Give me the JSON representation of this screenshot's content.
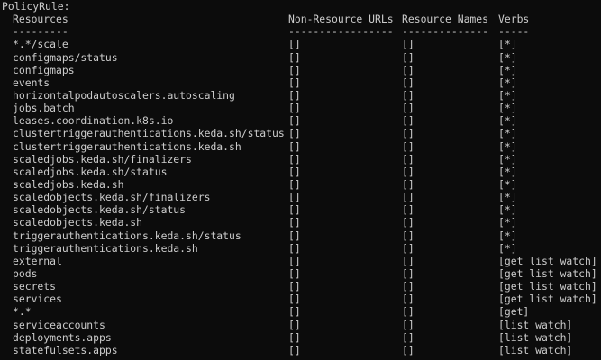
{
  "terminal": {
    "heading": "PolicyRule:",
    "columns": {
      "resources": "Resources",
      "non_resource_urls": "Non-Resource URLs",
      "resource_names": "Resource Names",
      "verbs": "Verbs"
    },
    "separators": {
      "resources": "---------",
      "non_resource_urls": "-----------------",
      "resource_names": "--------------",
      "verbs": "-----"
    },
    "rows": [
      {
        "resource": "*.*/scale",
        "non_resource_urls": "[]",
        "resource_names": "[]",
        "verbs": "[*]"
      },
      {
        "resource": "configmaps/status",
        "non_resource_urls": "[]",
        "resource_names": "[]",
        "verbs": "[*]"
      },
      {
        "resource": "configmaps",
        "non_resource_urls": "[]",
        "resource_names": "[]",
        "verbs": "[*]"
      },
      {
        "resource": "events",
        "non_resource_urls": "[]",
        "resource_names": "[]",
        "verbs": "[*]"
      },
      {
        "resource": "horizontalpodautoscalers.autoscaling",
        "non_resource_urls": "[]",
        "resource_names": "[]",
        "verbs": "[*]"
      },
      {
        "resource": "jobs.batch",
        "non_resource_urls": "[]",
        "resource_names": "[]",
        "verbs": "[*]"
      },
      {
        "resource": "leases.coordination.k8s.io",
        "non_resource_urls": "[]",
        "resource_names": "[]",
        "verbs": "[*]"
      },
      {
        "resource": "clustertriggerauthentications.keda.sh/status",
        "non_resource_urls": "[]",
        "resource_names": "[]",
        "verbs": "[*]"
      },
      {
        "resource": "clustertriggerauthentications.keda.sh",
        "non_resource_urls": "[]",
        "resource_names": "[]",
        "verbs": "[*]"
      },
      {
        "resource": "scaledjobs.keda.sh/finalizers",
        "non_resource_urls": "[]",
        "resource_names": "[]",
        "verbs": "[*]"
      },
      {
        "resource": "scaledjobs.keda.sh/status",
        "non_resource_urls": "[]",
        "resource_names": "[]",
        "verbs": "[*]"
      },
      {
        "resource": "scaledjobs.keda.sh",
        "non_resource_urls": "[]",
        "resource_names": "[]",
        "verbs": "[*]"
      },
      {
        "resource": "scaledobjects.keda.sh/finalizers",
        "non_resource_urls": "[]",
        "resource_names": "[]",
        "verbs": "[*]"
      },
      {
        "resource": "scaledobjects.keda.sh/status",
        "non_resource_urls": "[]",
        "resource_names": "[]",
        "verbs": "[*]"
      },
      {
        "resource": "scaledobjects.keda.sh",
        "non_resource_urls": "[]",
        "resource_names": "[]",
        "verbs": "[*]"
      },
      {
        "resource": "triggerauthentications.keda.sh/status",
        "non_resource_urls": "[]",
        "resource_names": "[]",
        "verbs": "[*]"
      },
      {
        "resource": "triggerauthentications.keda.sh",
        "non_resource_urls": "[]",
        "resource_names": "[]",
        "verbs": "[*]"
      },
      {
        "resource": "external",
        "non_resource_urls": "[]",
        "resource_names": "[]",
        "verbs": "[get list watch]"
      },
      {
        "resource": "pods",
        "non_resource_urls": "[]",
        "resource_names": "[]",
        "verbs": "[get list watch]"
      },
      {
        "resource": "secrets",
        "non_resource_urls": "[]",
        "resource_names": "[]",
        "verbs": "[get list watch]"
      },
      {
        "resource": "services",
        "non_resource_urls": "[]",
        "resource_names": "[]",
        "verbs": "[get list watch]"
      },
      {
        "resource": "*.*",
        "non_resource_urls": "[]",
        "resource_names": "[]",
        "verbs": "[get]"
      },
      {
        "resource": "serviceaccounts",
        "non_resource_urls": "[]",
        "resource_names": "[]",
        "verbs": "[list watch]"
      },
      {
        "resource": "deployments.apps",
        "non_resource_urls": "[]",
        "resource_names": "[]",
        "verbs": "[list watch]"
      },
      {
        "resource": "statefulsets.apps",
        "non_resource_urls": "[]",
        "resource_names": "[]",
        "verbs": "[list watch]"
      }
    ]
  },
  "colors": {
    "background": "#0c0c0c",
    "text": "#cccccc"
  }
}
